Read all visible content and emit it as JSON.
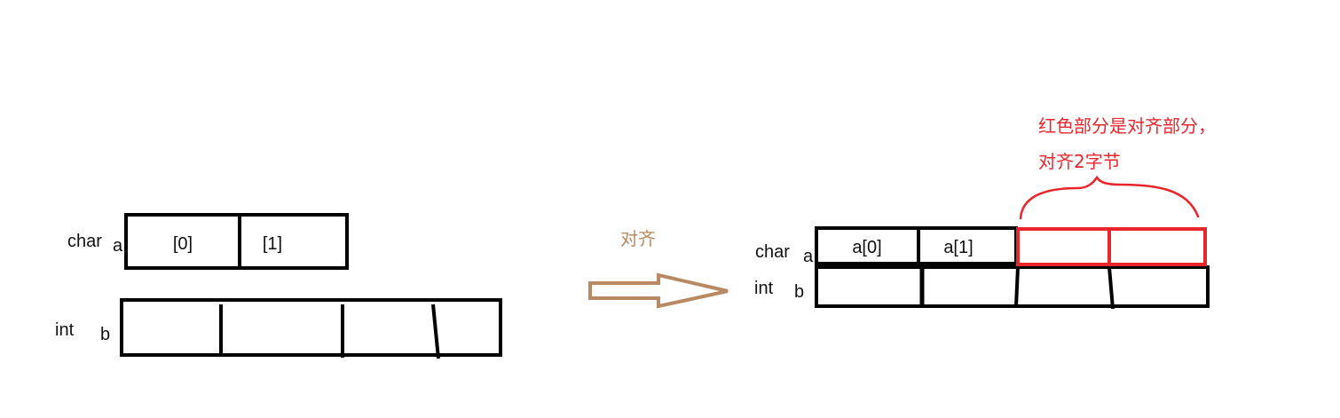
{
  "colors": {
    "stroke": "#000000",
    "highlight": "#e8262b",
    "arrow": "#b98963",
    "text": "#111111"
  },
  "before": {
    "char_label": "char",
    "char_var": "a",
    "char_cells": [
      "[0]",
      "[1]"
    ],
    "int_label": "int",
    "int_var": "b"
  },
  "arrow": {
    "label": "对齐",
    "icon": "hollow-right-arrow"
  },
  "after": {
    "char_label": "char",
    "char_var": "a",
    "char_cells": [
      "a[0]",
      "a[1]"
    ],
    "int_label": "int",
    "int_var": "b"
  },
  "annotation": {
    "line1": "红色部分是对齐部分，",
    "line2": "对齐2字节",
    "icon": "curly-brace"
  }
}
